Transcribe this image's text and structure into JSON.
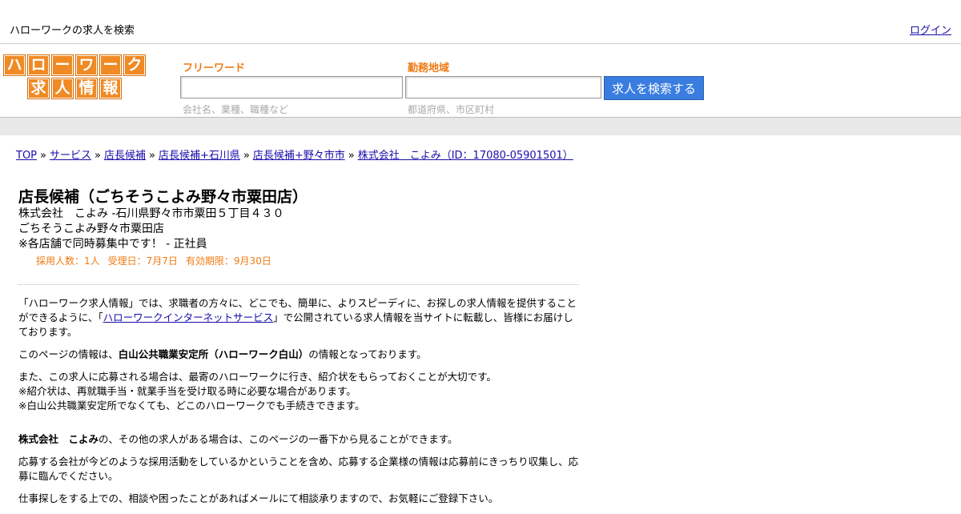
{
  "topbar": {
    "site_title": "ハローワークの求人を検索",
    "login": "ログイン"
  },
  "logo": {
    "row1": [
      "ハ",
      "ロ",
      "ー",
      "ワ",
      "ー",
      "ク"
    ],
    "row2": [
      "求",
      "人",
      "情",
      "報"
    ]
  },
  "search": {
    "keyword_label": "フリーワード",
    "keyword_value": "",
    "keyword_hint": "会社名、業種、職種など",
    "area_label": "勤務地域",
    "area_value": "",
    "area_hint": "都道府県、市区町村",
    "button": "求人を検索する"
  },
  "breadcrumb": [
    "TOP",
    "サービス",
    "店長候補",
    "店長候補+石川県",
    "店長候補+野々市市",
    "株式会社　こよみ（ID：17080-05901501）"
  ],
  "job": {
    "title": "店長候補（ごちそうこよみ野々市粟田店）",
    "company_line": "株式会社　こよみ -石川県野々市市粟田５丁目４３０",
    "store": "ごちそうこよみ野々市粟田店",
    "note": "※各店舗で同時募集中です！ - 正社員",
    "meta": {
      "hires": "採用人数：1人",
      "received": "受理日：7月7日",
      "expires": "有効期限：9月30日"
    }
  },
  "intro": {
    "p1_a": "「ハローワーク求人情報」では、求職者の方々に、どこでも、簡単に、よりスピーディに、お探しの求人情報を提供することができるように、「",
    "p1_link": "ハローワークインターネットサービス",
    "p1_b": "」で公開されている求人情報を当サイトに転載し、皆様にお届けしております。",
    "p2_a": "このページの情報は、",
    "p2_bold": "白山公共職業安定所（ハローワーク白山）",
    "p2_b": "の情報となっております。",
    "p3_1": "また、この求人に応募される場合は、最寄のハローワークに行き、紹介状をもらっておくことが大切です。",
    "p3_2": "※紹介状は、再就職手当・就業手当を受け取る時に必要な場合があります。",
    "p3_3": "※白山公共職業安定所でなくても、どこのハローワークでも手続きできます。",
    "p4_bold": "株式会社　こよみ",
    "p4_b": "の、その他の求人がある場合は、このページの一番下から見ることができます。",
    "p5": "応募する会社が今どのような採用活動をしているかということを含め、応募する企業様の情報は応募前にきっちり収集し、応募に臨んでください。",
    "p6": "仕事探しをする上での、相談や困ったことがあればメールにて相談承りますので、お気軽にご登録下さい。"
  }
}
